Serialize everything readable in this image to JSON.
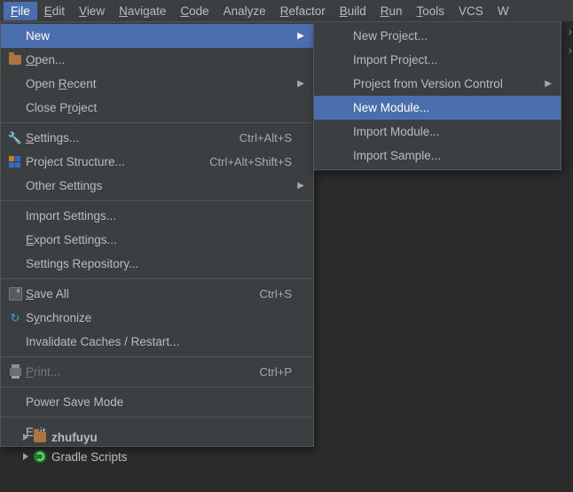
{
  "menubar": {
    "items": [
      {
        "label": "File",
        "active": true,
        "mn": 0
      },
      {
        "label": "Edit",
        "mn": 0
      },
      {
        "label": "View",
        "mn": 0
      },
      {
        "label": "Navigate",
        "mn": 0
      },
      {
        "label": "Code",
        "mn": 0
      },
      {
        "label": "Analyze"
      },
      {
        "label": "Refactor",
        "mn": 0
      },
      {
        "label": "Build",
        "mn": 0
      },
      {
        "label": "Run",
        "mn": 0
      },
      {
        "label": "Tools",
        "mn": 0
      },
      {
        "label": "VCS"
      },
      {
        "label": "W"
      }
    ]
  },
  "file_menu": {
    "items": [
      {
        "label": "New",
        "highlight": true,
        "submenu": true
      },
      {
        "label": "Open...",
        "mn": 0,
        "icon": "folder"
      },
      {
        "label": "Open Recent",
        "mn": 5,
        "submenu": true
      },
      {
        "label": "Close Project",
        "mn": 7
      },
      {
        "sep": true
      },
      {
        "label": "Settings...",
        "mn": 0,
        "shortcut": "Ctrl+Alt+S",
        "icon": "wrench"
      },
      {
        "label": "Project Structure...",
        "shortcut": "Ctrl+Alt+Shift+S",
        "icon": "struct"
      },
      {
        "label": "Other Settings",
        "submenu": true
      },
      {
        "sep": true
      },
      {
        "label": "Import Settings..."
      },
      {
        "label": "Export Settings...",
        "mn": 0
      },
      {
        "label": "Settings Repository..."
      },
      {
        "sep": true
      },
      {
        "label": "Save All",
        "mn": 0,
        "shortcut": "Ctrl+S",
        "icon": "disk"
      },
      {
        "label": "Synchronize",
        "mn": 1,
        "icon": "sync"
      },
      {
        "label": "Invalidate Caches / Restart..."
      },
      {
        "sep": true
      },
      {
        "label": "Print...",
        "mn": 0,
        "shortcut": "Ctrl+P",
        "icon": "print",
        "disabled": true
      },
      {
        "sep": true
      },
      {
        "label": "Power Save Mode"
      },
      {
        "sep": true
      },
      {
        "label": "Exit",
        "mn": 1
      }
    ]
  },
  "new_submenu": {
    "items": [
      {
        "label": "New Project..."
      },
      {
        "label": "Import Project..."
      },
      {
        "label": "Project from Version Control",
        "submenu": true
      },
      {
        "label": "New Module...",
        "highlight": true
      },
      {
        "label": "Import Module..."
      },
      {
        "label": "Import Sample..."
      }
    ]
  },
  "tree": {
    "items": [
      {
        "label": "zhufuyu",
        "icon": "folder",
        "bold": true
      },
      {
        "label": "Gradle Scripts",
        "icon": "gradle"
      }
    ]
  },
  "rightedge_glyph": "›"
}
